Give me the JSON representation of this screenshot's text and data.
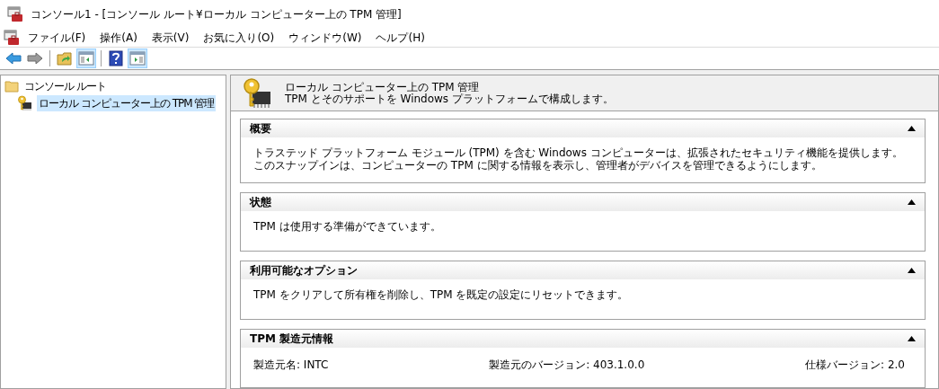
{
  "window": {
    "title": "コンソール1 - [コンソール ルート¥ローカル コンピューター上の TPM 管理]"
  },
  "menu": [
    "ファイル(F)",
    "操作(A)",
    "表示(V)",
    "お気に入り(O)",
    "ウィンドウ(W)",
    "ヘルプ(H)"
  ],
  "toolbar": [
    {
      "kind": "back",
      "pressed": false
    },
    {
      "kind": "forward",
      "pressed": false
    },
    {
      "kind": "separator"
    },
    {
      "kind": "up",
      "pressed": false
    },
    {
      "kind": "tree",
      "pressed": true
    },
    {
      "kind": "separator"
    },
    {
      "kind": "help",
      "pressed": false
    },
    {
      "kind": "action",
      "pressed": true
    }
  ],
  "tree": [
    {
      "label": "コンソール ルート",
      "selected": false,
      "children": [
        {
          "label": "ローカル コンピューター上の TPM 管理",
          "selected": true
        }
      ]
    }
  ],
  "header": {
    "title": "ローカル コンピューター上の TPM 管理",
    "subtitle": "TPM とそのサポートを Windows プラットフォームで構成します。"
  },
  "sections": [
    {
      "title": "概要",
      "expanded": true,
      "kind": "text",
      "text": "トラステッド プラットフォーム モジュール (TPM) を含む Windows コンピューターは、拡張されたセキュリティ機能を提供します。このスナップインは、コンピューターの TPM に関する情報を表示し、管理者がデバイスを管理できるようにします。"
    },
    {
      "title": "状態",
      "expanded": true,
      "kind": "text",
      "text": "TPM は使用する準備ができています。"
    },
    {
      "title": "利用可能なオプション",
      "expanded": true,
      "kind": "text",
      "text": "TPM をクリアして所有権を削除し、TPM を既定の設定にリセットできます。"
    },
    {
      "title": "TPM 製造元情報",
      "expanded": true,
      "kind": "fields",
      "fields": [
        "製造元名: INTC",
        "製造元のバージョン: 403.1.0.0",
        "仕様バージョン: 2.0"
      ]
    }
  ]
}
